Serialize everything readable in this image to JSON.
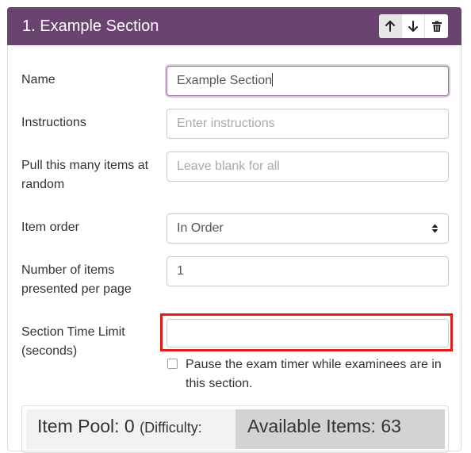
{
  "section": {
    "title": "1. Example Section",
    "buttons": {
      "move_up_icon": "arrow-up-icon",
      "move_down_icon": "arrow-down-icon",
      "delete_icon": "trash-icon"
    },
    "colors": {
      "header_bg": "#6b4370",
      "highlight": "#e21b1b"
    }
  },
  "form": {
    "name": {
      "label": "Name",
      "value": "Example Section"
    },
    "instructions": {
      "label": "Instructions",
      "placeholder": "Enter instructions"
    },
    "pull_items": {
      "label_line1": "Pull this many items at",
      "label_line2": "random",
      "placeholder": "Leave blank for all"
    },
    "item_order": {
      "label": "Item order",
      "selected": "In Order"
    },
    "items_per_page": {
      "label_line1": "Number of items",
      "label_line2": "presented per page",
      "value": "1"
    },
    "time_limit": {
      "label_line1": "Section Time Limit",
      "label_line2": "(seconds)",
      "value": ""
    },
    "pause_timer": {
      "label_line1": "Pause the exam timer while examinees are in",
      "label_line2": "this section.",
      "checked": false
    }
  },
  "pool": {
    "item_pool_label": "Item Pool: 0",
    "difficulty_label": "(Difficulty:",
    "available_label": "Available Items: 63"
  }
}
